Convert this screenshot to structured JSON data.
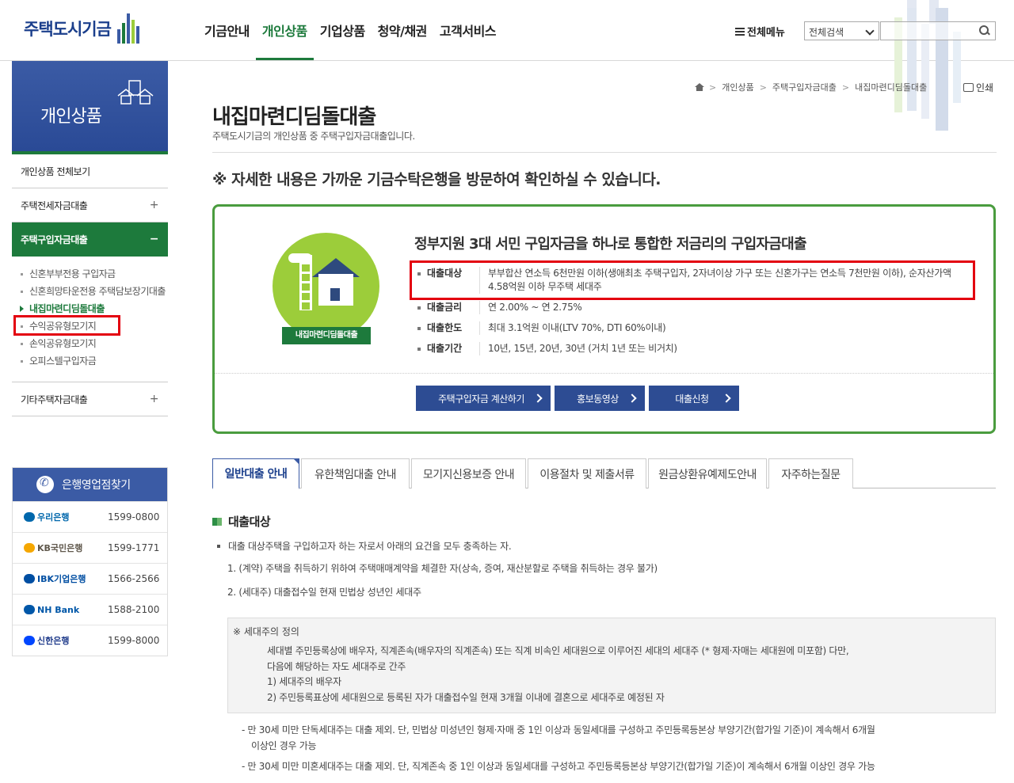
{
  "header": {
    "logo_text": "주택도시기금",
    "nav": [
      "기금안내",
      "개인상품",
      "기업상품",
      "청약/채권",
      "고객서비스"
    ],
    "nav_active_index": 1,
    "all_menu": "전체메뉴",
    "search_select": "전체검색",
    "search_value": ""
  },
  "colors": {
    "brand_blue": "#3b5ba5",
    "brand_green": "#1d7a3c",
    "highlight_red": "#e3000f"
  },
  "lnb": {
    "title": "개인상품",
    "items": [
      {
        "label": "개인상품 전체보기",
        "toggle": ""
      },
      {
        "label": "주택전세자금대출",
        "toggle": "+"
      },
      {
        "label": "주택구입자금대출",
        "toggle": "−"
      }
    ],
    "sub_items": [
      "신혼부부전용 구입자금",
      "신혼희망타운전용 주택담보장기대출",
      "내집마련디딤돌대출",
      "수익공유형모기지",
      "손익공유형모기지",
      "오피스텔구입자금"
    ],
    "sub_current_index": 2,
    "last_item": {
      "label": "기타주택자금대출",
      "toggle": "+"
    }
  },
  "bank_finder": {
    "title": "은행영업점찾기",
    "banks": [
      {
        "name": "우리은행",
        "phone": "1599-0800",
        "color": "#0067ac"
      },
      {
        "name": "KB국민은행",
        "phone": "1599-1771",
        "color": "#f5a700"
      },
      {
        "name": "IBK기업은행",
        "phone": "1566-2566",
        "color": "#004ea2"
      },
      {
        "name": "NH Bank",
        "phone": "1588-2100",
        "color": "#0057a8"
      },
      {
        "name": "신한은행",
        "phone": "1599-8000",
        "color": "#0046ff"
      }
    ]
  },
  "breadcrumb": [
    "개인상품",
    "주택구입자금대출",
    "내집마련디딤돌대출"
  ],
  "print_label": "인쇄",
  "page": {
    "title": "내집마련디딤돌대출",
    "desc": "주택도시기금의 개인상품 중 주택구입자금대출입니다.",
    "notice": "※ 자세한 내용은 가까운 기금수탁은행을 방문하여 확인하실 수 있습니다."
  },
  "summary": {
    "image_label": "내집마련디딤돌대출",
    "headline": "정부지원 3대 서민 구입자금을 하나로 통합한 저금리의 구입자금대출",
    "rows": [
      {
        "key": "대출대상",
        "value": "부부합산 연소득 6천만원 이하(생애최초 주택구입자, 2자녀이상 가구 또는 신혼가구는 연소득 7천만원 이하), 순자산가액 4.58억원 이하 무주택 세대주"
      },
      {
        "key": "대출금리",
        "value": "연 2.00% ~ 연 2.75%"
      },
      {
        "key": "대출한도",
        "value": "최대 3.1억원 이내(LTV 70%, DTI 60%이내)"
      },
      {
        "key": "대출기간",
        "value": "10년, 15년, 20년, 30년 (거치 1년 또는 비거치)"
      }
    ],
    "buttons": [
      "주택구입자금 계산하기",
      "홍보동영상",
      "대출신청"
    ]
  },
  "tabs": [
    "일반대출 안내",
    "유한책임대출 안내",
    "모기지신용보증 안내",
    "이용절차 및 제출서류",
    "원금상환유예제도안내",
    "자주하는질문"
  ],
  "tab_active_index": 0,
  "body": {
    "section_title": "대출대상",
    "intro": "대출 대상주택을 구입하고자 하는 자로서 아래의 요건을 모두 충족하는 자.",
    "req1": "1. (계약) 주택을 취득하기 위하여 주택매매계약을 체결한 자(상속, 증여, 재산분할로 주택을 취득하는 경우 불가)",
    "req2": "2. (세대주) 대출접수일 현재 민법상 성년인 세대주",
    "def_title": "※ 세대주의 정의",
    "def_line1": "세대별 주민등록상에 배우자, 직계존속(배우자의 직계존속) 또는 직계 비속인 세대원으로 이루어진 세대의 세대주 (* 형제·자매는 세대원에 미포함) 다만,",
    "def_line2": "다음에 해당하는 자도 세대주로 간주",
    "def_line3": "1) 세대주의 배우자",
    "def_line4": "2) 주민등록표상에 세대원으로 등록된 자가 대출접수일 현재 3개월 이내에 결혼으로 세대주로 예정된 자",
    "note1a": "- 만 30세 미만 단독세대주는 대출 제외. 단, 민법상 미성년인 형제·자매 중 1인 이상과 동일세대를 구성하고 주민등록등본상 부양기간(합가일 기준)이 계속해서 6개월",
    "note1b": "이상인 경우 가능",
    "note2": "- 만 30세 미만 미혼세대주는 대출 제외. 단, 직계존속 중 1인 이상과 동일세대를 구성하고 주민등록등본상 부양기간(합가일 기준)이 계속해서 6개월 이상인 경우 가능"
  }
}
